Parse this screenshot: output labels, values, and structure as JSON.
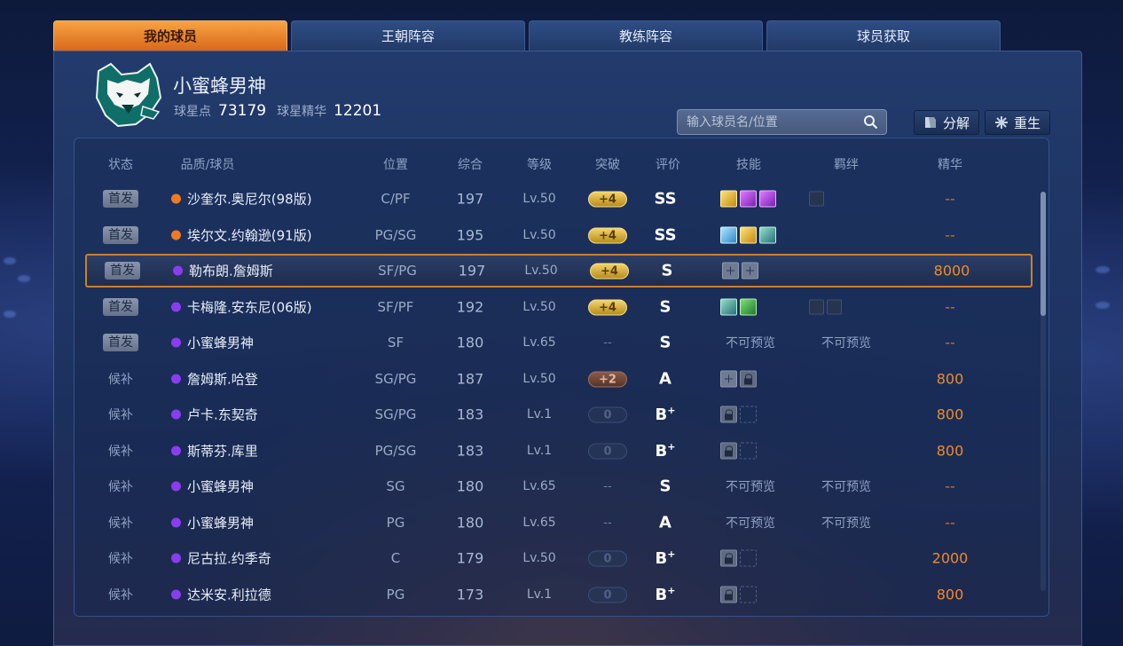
{
  "tabs": [
    "我的球员",
    "王朝阵容",
    "教练阵容",
    "球员获取"
  ],
  "profile": {
    "name": "小蜜蜂男神",
    "star_points_label": "球星点",
    "star_points_value": "73179",
    "essence_label": "球星精华",
    "essence_value": "12201"
  },
  "search": {
    "placeholder": "输入球员名/位置"
  },
  "buttons": {
    "decompose": "分解",
    "rebirth": "重生"
  },
  "columns": [
    "状态",
    "品质/球员",
    "位置",
    "综合",
    "等级",
    "突破",
    "评价",
    "技能",
    "羁绊",
    "精华"
  ],
  "colors": {
    "orange_quality": "#f07a1e",
    "purple_quality": "#8a3cf0",
    "accent": "#f08a2a",
    "active_tab": "#f7a341"
  },
  "rows": [
    {
      "status": "首发",
      "starter": true,
      "quality": "orange",
      "name": "沙奎尔.奥尼尔(98版)",
      "position": "C/PF",
      "overall": "197",
      "level": "Lv.50",
      "breakthrough": "+4",
      "break_type": "gold",
      "grade": "SS",
      "grade_plus": "",
      "skills": [
        "gold-skill-icon",
        "purple-skill-icon",
        "purple-skill-icon"
      ],
      "bonds": [
        "bond-icon"
      ],
      "essence": "--"
    },
    {
      "status": "首发",
      "starter": true,
      "quality": "orange",
      "name": "埃尔文.约翰逊(91版)",
      "position": "PG/SG",
      "overall": "195",
      "level": "Lv.50",
      "breakthrough": "+4",
      "break_type": "gold",
      "grade": "SS",
      "grade_plus": "",
      "skills": [
        "cyan-skill-icon",
        "gold-skill-icon",
        "teal-skill-icon"
      ],
      "bonds": [],
      "essence": "--"
    },
    {
      "status": "首发",
      "starter": true,
      "quality": "purple",
      "name": "勒布朗.詹姆斯",
      "position": "SF/PG",
      "overall": "197",
      "level": "Lv.50",
      "breakthrough": "+4",
      "break_type": "gold",
      "grade": "S",
      "grade_plus": "",
      "skills": [
        "add-skill-icon",
        "add-skill-icon"
      ],
      "bonds": [],
      "essence": "8000",
      "selected": true
    },
    {
      "status": "首发",
      "starter": true,
      "quality": "purple",
      "name": "卡梅隆.安东尼(06版)",
      "position": "SF/PF",
      "overall": "192",
      "level": "Lv.50",
      "breakthrough": "+4",
      "break_type": "gold",
      "grade": "S",
      "grade_plus": "",
      "skills": [
        "teal-skill-icon",
        "green-skill-icon"
      ],
      "bonds": [
        "bond-icon",
        "bond-icon"
      ],
      "essence": "--"
    },
    {
      "status": "首发",
      "starter": true,
      "quality": "purple",
      "name": "小蜜蜂男神",
      "position": "SF",
      "overall": "180",
      "level": "Lv.65",
      "breakthrough": "--",
      "break_type": "dash",
      "grade": "S",
      "grade_plus": "",
      "skills_text": "不可预览",
      "bonds_text": "不可预览",
      "essence": "--"
    },
    {
      "status": "候补",
      "starter": false,
      "quality": "purple",
      "name": "詹姆斯.哈登",
      "position": "SG/PG",
      "overall": "187",
      "level": "Lv.50",
      "breakthrough": "+2",
      "break_type": "bronze",
      "grade": "A",
      "grade_plus": "",
      "skills": [
        "add-skill-icon",
        "lock-skill-icon"
      ],
      "bonds": [],
      "essence": "800"
    },
    {
      "status": "候补",
      "starter": false,
      "quality": "purple",
      "name": "卢卡.东契奇",
      "position": "SG/PG",
      "overall": "183",
      "level": "Lv.1",
      "breakthrough": "0",
      "break_type": "empty",
      "grade": "B",
      "grade_plus": "+",
      "skills": [
        "lock-skill-icon",
        "empty-skill-slot"
      ],
      "bonds": [],
      "essence": "800"
    },
    {
      "status": "候补",
      "starter": false,
      "quality": "purple",
      "name": "斯蒂芬.库里",
      "position": "PG/SG",
      "overall": "183",
      "level": "Lv.1",
      "breakthrough": "0",
      "break_type": "empty",
      "grade": "B",
      "grade_plus": "+",
      "skills": [
        "lock-skill-icon",
        "empty-skill-slot"
      ],
      "bonds": [],
      "essence": "800"
    },
    {
      "status": "候补",
      "starter": false,
      "quality": "purple",
      "name": "小蜜蜂男神",
      "position": "SG",
      "overall": "180",
      "level": "Lv.65",
      "breakthrough": "--",
      "break_type": "dash",
      "grade": "S",
      "grade_plus": "",
      "skills_text": "不可预览",
      "bonds_text": "不可预览",
      "essence": "--"
    },
    {
      "status": "候补",
      "starter": false,
      "quality": "purple",
      "name": "小蜜蜂男神",
      "position": "PG",
      "overall": "180",
      "level": "Lv.65",
      "breakthrough": "--",
      "break_type": "dash",
      "grade": "A",
      "grade_plus": "",
      "skills_text": "不可预览",
      "bonds_text": "不可预览",
      "essence": "--"
    },
    {
      "status": "候补",
      "starter": false,
      "quality": "purple",
      "name": "尼古拉.约季奇",
      "position": "C",
      "overall": "179",
      "level": "Lv.50",
      "breakthrough": "0",
      "break_type": "empty",
      "grade": "B",
      "grade_plus": "+",
      "skills": [
        "lock-skill-icon",
        "empty-skill-slot"
      ],
      "bonds": [],
      "essence": "2000"
    },
    {
      "status": "候补",
      "starter": false,
      "quality": "purple",
      "name": "达米安.利拉德",
      "position": "PG",
      "overall": "173",
      "level": "Lv.1",
      "breakthrough": "0",
      "break_type": "empty",
      "grade": "B",
      "grade_plus": "+",
      "skills": [
        "lock-skill-icon",
        "empty-skill-slot"
      ],
      "bonds": [],
      "essence": "800"
    }
  ]
}
